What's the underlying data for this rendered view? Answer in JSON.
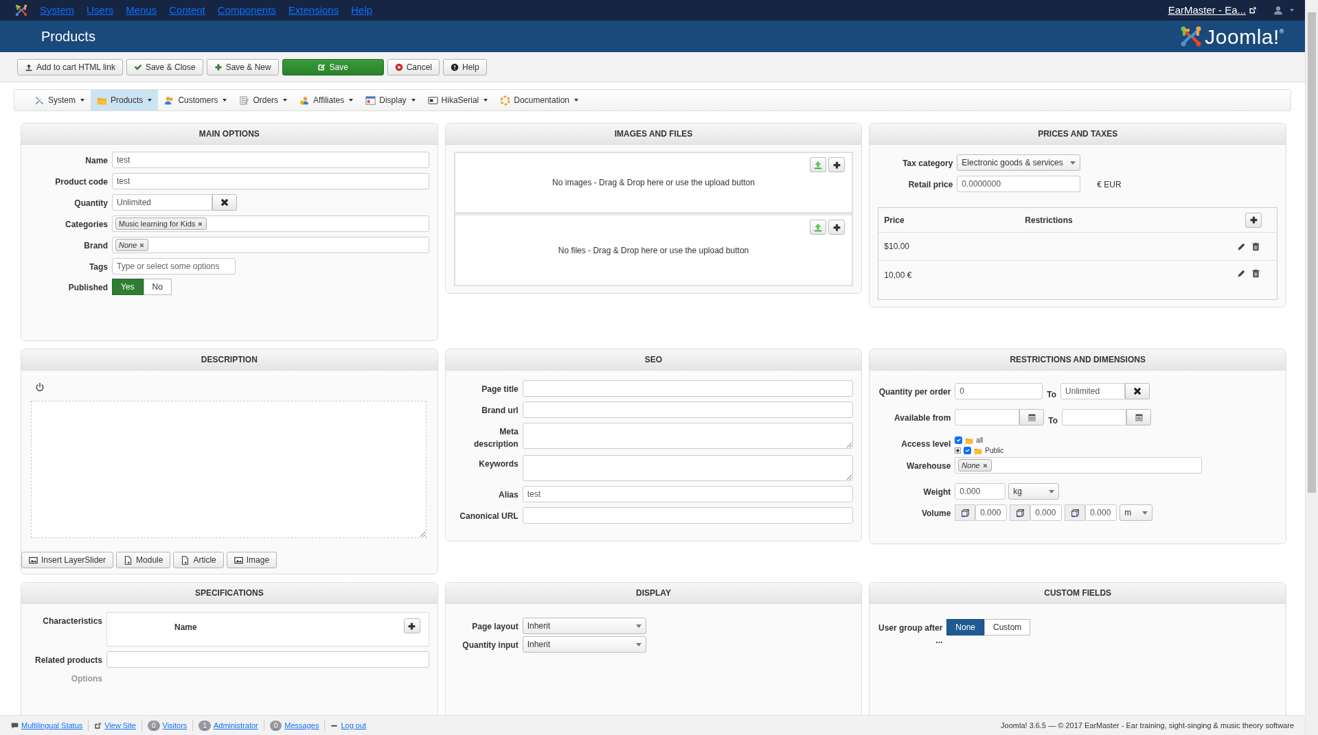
{
  "top_menu": {
    "items": [
      "System",
      "Users",
      "Menus",
      "Content",
      "Components",
      "Extensions",
      "Help"
    ],
    "site_link": "EarMaster - Ea..."
  },
  "header": {
    "title": "Products",
    "logo": "Joomla!$^{®}$"
  },
  "toolbar": [
    {
      "label": "Add to cart HTML link",
      "kind": "default"
    },
    {
      "label": "Save & Close",
      "kind": "default"
    },
    {
      "label": "Save & New",
      "kind": "default"
    },
    {
      "label": "Save",
      "kind": "success"
    },
    {
      "label": "Cancel",
      "kind": "default"
    },
    {
      "label": "Help",
      "kind": "default"
    }
  ],
  "submenu": [
    {
      "label": "System",
      "selected": false
    },
    {
      "label": "Products",
      "selected": true
    },
    {
      "label": "Customers",
      "selected": false
    },
    {
      "label": "Orders",
      "selected": false
    },
    {
      "label": "Affiliates",
      "selected": false
    },
    {
      "label": "Display",
      "selected": false
    },
    {
      "label": "HikaSerial",
      "selected": false
    },
    {
      "label": "Documentation",
      "selected": false
    }
  ],
  "main_options": {
    "title": "MAIN OPTIONS",
    "fields": [
      {
        "label": "Name",
        "kind": "text",
        "value": "test"
      },
      {
        "label": "Product code",
        "kind": "text",
        "value": "test"
      },
      {
        "label": "Quantity",
        "kind": "clearable",
        "value": "Unlimited"
      },
      {
        "label": "Categories",
        "kind": "tags",
        "tags": [
          {
            "label": "Music learning for Kids",
            "kind": "value"
          }
        ]
      },
      {
        "label": "Brand",
        "kind": "tags",
        "tags": [
          {
            "label": "None",
            "kind": "empty"
          }
        ]
      },
      {
        "label": "Tags",
        "kind": "short",
        "placeholder": "Type or select some options"
      },
      {
        "label": "Published",
        "kind": "toggle",
        "options": [
          {
            "label": "Yes",
            "selected": true
          },
          {
            "label": "No",
            "selected": false
          }
        ]
      }
    ]
  },
  "images_and_files": {
    "title": "IMAGES AND FILES",
    "zones": [
      "No images - Drag & Drop here or use the upload button",
      "No files - Drag & Drop here or use the upload button"
    ]
  },
  "prices_and_taxes": {
    "title": "PRICES AND TAXES",
    "tax_category": {
      "label": "Tax category",
      "value": "Electronic goods & services"
    },
    "retail_price": {
      "label": "Retail price",
      "value": "0.0000000",
      "currency": "€ EUR"
    },
    "price_table": {
      "columns": [
        "Price",
        "Restrictions"
      ],
      "rows": [
        "$10.00",
        "10,00 €"
      ]
    }
  },
  "description": {
    "title": "DESCRIPTION",
    "buttons": [
      "Insert LayerSlider",
      "Module",
      "Article",
      "Image"
    ]
  },
  "seo": {
    "title": "SEO",
    "fields": [
      {
        "label": "Page title",
        "kind": "text"
      },
      {
        "label": "Brand url",
        "kind": "text"
      },
      {
        "label": "Meta description",
        "kind": "textarea"
      },
      {
        "label": "Keywords",
        "kind": "textarea"
      },
      {
        "label": "Alias",
        "kind": "text",
        "value": "test"
      },
      {
        "label": "Canonical URL",
        "kind": "text"
      }
    ]
  },
  "restrictions": {
    "title": "RESTRICTIONS AND DIMENSIONS",
    "quantity_per_order": {
      "label": "Quantity per order",
      "from": "0",
      "to_label": "To",
      "to": "Unlimited"
    },
    "available_from": {
      "label": "Available from",
      "to_label": "To"
    },
    "access_level": {
      "label": "Access level",
      "tree": [
        {
          "label": "all",
          "checked": true
        },
        {
          "label": "Public",
          "checked": true,
          "expanded": false
        }
      ]
    },
    "warehouse": {
      "label": "Warehouse",
      "tag": "None"
    },
    "weight": {
      "label": "Weight",
      "value": "0.000",
      "unit": "kg"
    },
    "volume": {
      "label": "Volume",
      "values": [
        "0.000",
        "0.000",
        "0.000"
      ],
      "unit": "m"
    }
  },
  "specifications": {
    "title": "SPECIFICATIONS",
    "characteristics": {
      "label": "Characteristics",
      "column": "Name"
    },
    "related_products": {
      "label": "Related products"
    },
    "options": {
      "label": "Options"
    }
  },
  "display": {
    "title": "DISPLAY",
    "fields": [
      {
        "label": "Page layout",
        "value": "Inherit"
      },
      {
        "label": "Quantity input",
        "value": "Inherit"
      }
    ]
  },
  "custom_fields": {
    "title": "CUSTOM FIELDS",
    "label": "User group after ...",
    "options": [
      {
        "label": "None",
        "selected": true
      },
      {
        "label": "Custom",
        "selected": false
      }
    ]
  },
  "status_bar": {
    "items": [
      {
        "label": "Multilingual Status"
      },
      {
        "label": "View Site"
      },
      {
        "label": "Visitors",
        "count": "0"
      },
      {
        "label": "Administrator",
        "count": "1"
      },
      {
        "label": "Messages",
        "count": "0"
      },
      {
        "label": "Log out"
      }
    ],
    "copyright": "Joomla! 3.6.5 — © 2017 EarMaster - Ear training, sight-singing & music theory software"
  }
}
